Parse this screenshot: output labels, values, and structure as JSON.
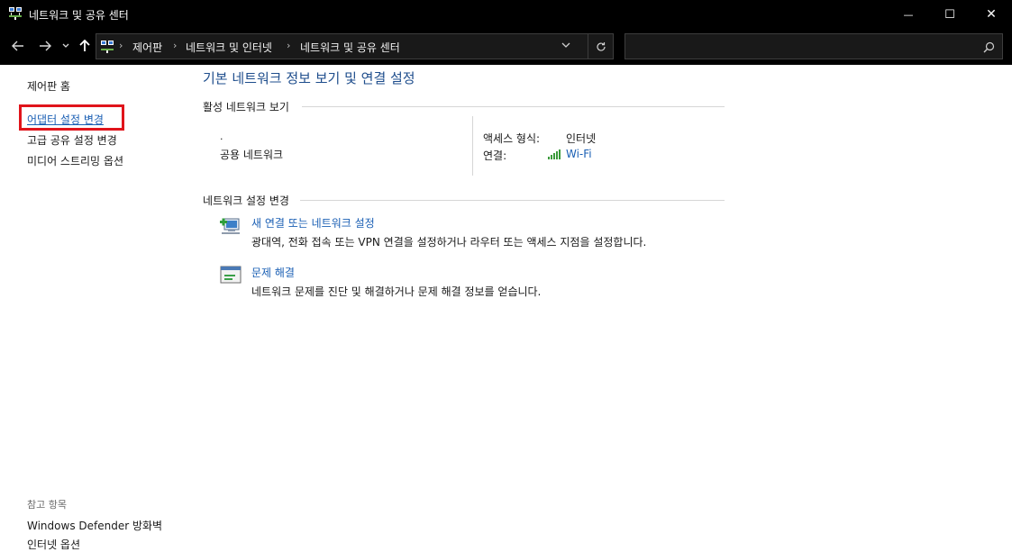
{
  "window": {
    "title": "네트워크 및 공유 센터",
    "minimize_glyph": "—",
    "maximize_glyph": "☐",
    "close_glyph": "✕"
  },
  "nav": {
    "breadcrumb": [
      "제어판",
      "네트워크 및 인터넷",
      "네트워크 및 공유 센터"
    ],
    "breadcrumb_separator": "›",
    "search_placeholder": ""
  },
  "sidebar": {
    "home": "제어판 홈",
    "links": [
      "어댑터 설정 변경",
      "고급 공유 설정 변경",
      "미디어 스트리밍 옵션"
    ],
    "see_also_title": "참고 항목",
    "see_also": [
      "Windows Defender 방화벽",
      "인터넷 옵션"
    ]
  },
  "main": {
    "heading": "기본 네트워크 정보 보기 및 연결 설정",
    "active_networks_title": "활성 네트워크 보기",
    "network": {
      "name": ".",
      "type": "공용 네트워크",
      "access_type_label": "액세스 형식:",
      "access_type_value": "인터넷",
      "connections_label": "연결:",
      "connection_value": "Wi-Fi"
    },
    "change_settings_title": "네트워크 설정 변경",
    "tasks": [
      {
        "icon": "new-connection-icon",
        "title": "새 연결 또는 네트워크 설정",
        "description": "광대역, 전화 접속 또는 VPN 연결을 설정하거나 라우터 또는 액세스 지점을 설정합니다."
      },
      {
        "icon": "troubleshoot-icon",
        "title": "문제 해결",
        "description": "네트워크 문제를 진단 및 해결하거나 문제 해결 정보를 얻습니다."
      }
    ]
  },
  "colors": {
    "titlebar_bg": "#000000",
    "link_blue": "#1a5fb4",
    "heading_blue": "#1e4d8c",
    "highlight_red": "#e0141b"
  }
}
